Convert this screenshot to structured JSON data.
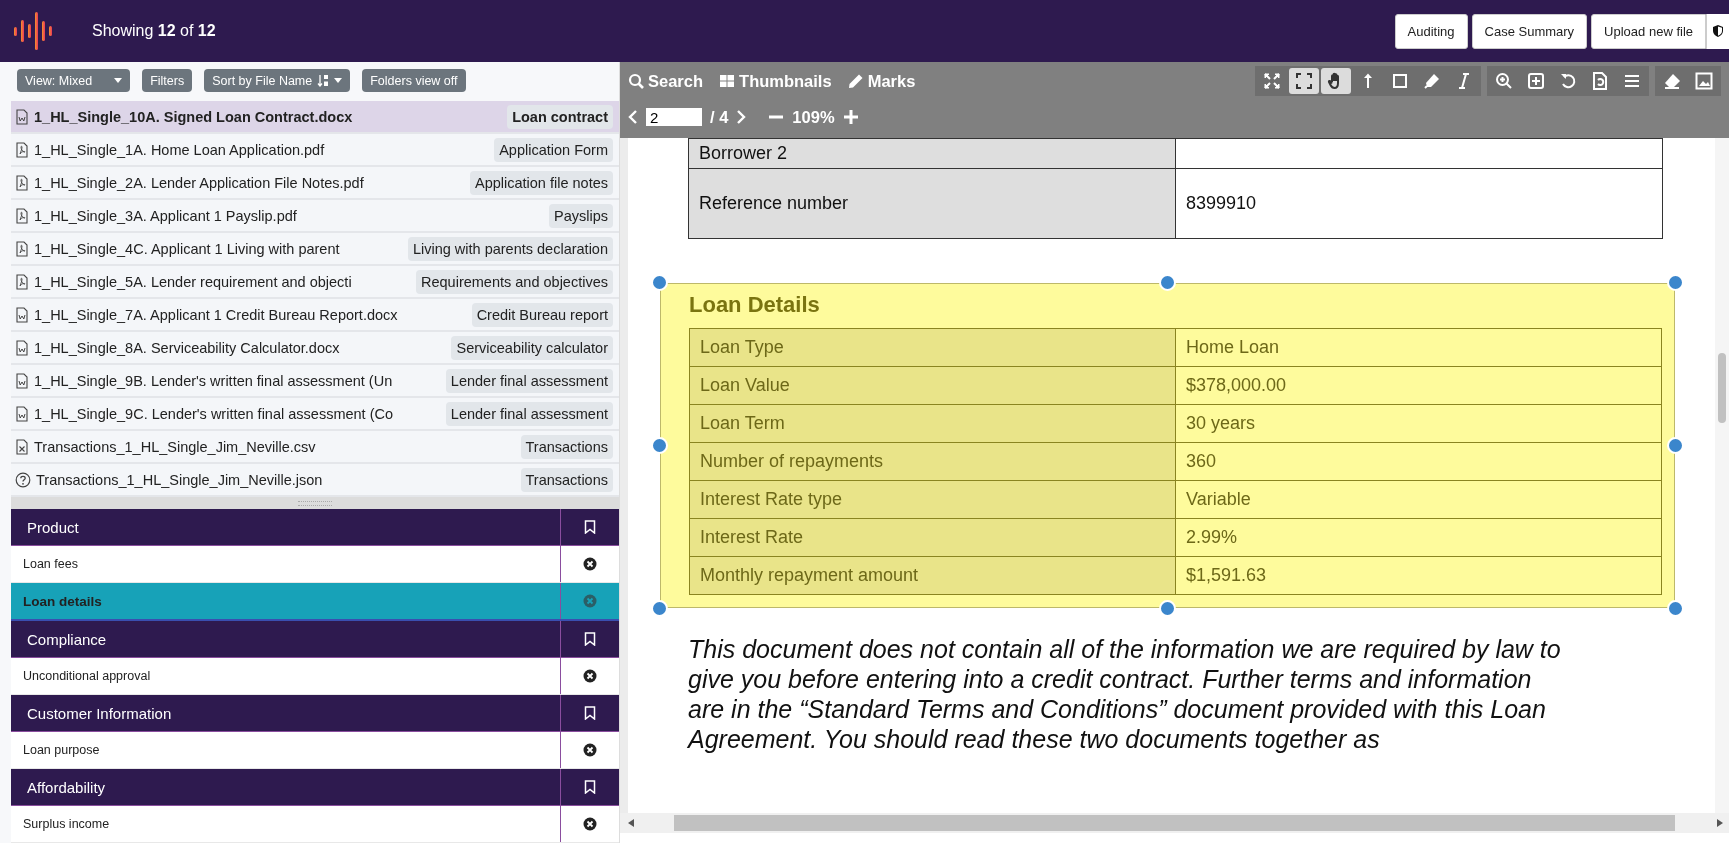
{
  "header": {
    "count_text": "Showing **12** of **12**",
    "buttons": [
      "Auditing",
      "Case Summary",
      "Upload new file"
    ]
  },
  "file_toolbar": [
    {
      "label": "View: Mixed",
      "kind": "dropdown"
    },
    {
      "label": "Filters",
      "kind": "plain"
    },
    {
      "label": "Sort by File Name",
      "kind": "sort"
    },
    {
      "label": "Folders view off",
      "kind": "plain"
    }
  ],
  "files": [
    {
      "name": "1_HL_Single_10A. Signed Loan Contract.docx",
      "tag": "Loan contract",
      "kind": "word",
      "selected": true
    },
    {
      "name": "1_HL_Single_1A. Home Loan Application.pdf",
      "tag": "Application Form",
      "kind": "pdf",
      "selected": false
    },
    {
      "name": "1_HL_Single_2A. Lender Application File Notes.pdf",
      "tag": "Application file notes",
      "kind": "pdf",
      "selected": false
    },
    {
      "name": "1_HL_Single_3A. Applicant 1 Payslip.pdf",
      "tag": "Payslips",
      "kind": "pdf",
      "selected": false
    },
    {
      "name": "1_HL_Single_4C. Applicant 1 Living with parent",
      "tag": "Living with parents declaration",
      "kind": "pdf",
      "selected": false
    },
    {
      "name": "1_HL_Single_5A. Lender requirement and objecti",
      "tag": "Requirements and objectives",
      "kind": "pdf",
      "selected": false
    },
    {
      "name": "1_HL_Single_7A. Applicant 1 Credit Bureau Report.docx",
      "tag": "Credit Bureau report",
      "kind": "word",
      "selected": false
    },
    {
      "name": "1_HL_Single_8A. Serviceability Calculator.docx",
      "tag": "Serviceability calculator",
      "kind": "word",
      "selected": false
    },
    {
      "name": "1_HL_Single_9B. Lender's written final assessment (Un",
      "tag": "Lender final assessment",
      "kind": "word",
      "selected": false
    },
    {
      "name": "1_HL_Single_9C. Lender's written final assessment (Co",
      "tag": "Lender final assessment",
      "kind": "word",
      "selected": false
    },
    {
      "name": "Transactions_1_HL_Single_Jim_Neville.csv",
      "tag": "Transactions",
      "kind": "spreadsheet",
      "selected": false
    },
    {
      "name": "Transactions_1_HL_Single_Jim_Neville.json",
      "tag": "Transactions",
      "kind": "unknown",
      "selected": false
    }
  ],
  "checklist": [
    {
      "heading": "Product",
      "items": [
        {
          "label": "Loan fees",
          "selected": false
        },
        {
          "label": "Loan details",
          "selected": true
        }
      ]
    },
    {
      "heading": "Compliance",
      "items": [
        {
          "label": "Unconditional approval",
          "selected": false
        }
      ]
    },
    {
      "heading": "Customer Information",
      "items": [
        {
          "label": "Loan purpose",
          "selected": false
        }
      ]
    },
    {
      "heading": "Affordability",
      "items": [
        {
          "label": "Surplus income",
          "selected": false
        }
      ]
    }
  ],
  "viewer": {
    "tools": [
      {
        "label": "Search",
        "kind": "search"
      },
      {
        "label": "Thumbnails",
        "kind": "thumbnails"
      },
      {
        "label": "Marks",
        "kind": "marks"
      }
    ],
    "tool_groups": [
      [
        {
          "kind": "expand",
          "selected": false
        },
        {
          "kind": "fullscreen",
          "selected": true
        },
        {
          "kind": "hand",
          "selected": true
        },
        {
          "kind": "arrow",
          "selected": false
        },
        {
          "kind": "square",
          "selected": false
        },
        {
          "kind": "marker",
          "selected": false
        },
        {
          "kind": "text",
          "selected": false
        }
      ],
      [
        {
          "kind": "zoom",
          "selected": false
        },
        {
          "kind": "addbox",
          "selected": false
        },
        {
          "kind": "undo",
          "selected": false
        },
        {
          "kind": "page",
          "selected": false
        },
        {
          "kind": "menu",
          "selected": false
        }
      ],
      [
        {
          "kind": "eraser",
          "selected": false
        },
        {
          "kind": "image",
          "selected": false
        }
      ]
    ],
    "page": "2",
    "page_total": "/ 4",
    "zoom": "109%"
  },
  "document": {
    "top_rows": [
      {
        "label": "Borrower 2"
      },
      {
        "label": "Reference number",
        "value": "8399910"
      }
    ],
    "section": {
      "title": "Loan Details",
      "selected": true,
      "rows": [
        {
          "label": "Loan Type",
          "value": "Home Loan"
        },
        {
          "label": "Loan Value",
          "value": "$378,000.00"
        },
        {
          "label": "Loan Term",
          "value": "30 years"
        },
        {
          "label": "Number of repayments",
          "value": "360"
        },
        {
          "label": "Interest Rate type",
          "value": "Variable"
        },
        {
          "label": "Interest Rate",
          "value": "2.99%"
        },
        {
          "label": "Monthly repayment amount",
          "value": "$1,591.63"
        }
      ]
    },
    "paragraph": "This document does not contain all of the information we are required by law to give you before entering into a credit contract. Further terms and information are in the “Standard Terms and Conditions” document provided with this Loan Agreement. You should read these two documents together as"
  }
}
